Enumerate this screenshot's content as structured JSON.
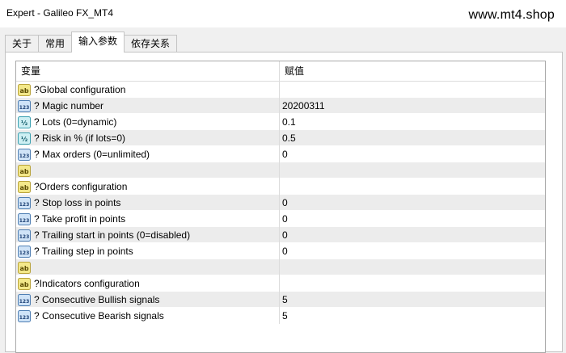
{
  "window": {
    "title": "Expert - Galileo FX_MT4",
    "watermark": "www.mt4.shop"
  },
  "tabs": [
    {
      "label": "关于",
      "active": false
    },
    {
      "label": "常用",
      "active": false
    },
    {
      "label": "输入参数",
      "active": true
    },
    {
      "label": "依存关系",
      "active": false
    }
  ],
  "table": {
    "headers": [
      "变量",
      "赋值"
    ],
    "rows": [
      {
        "icon": "ab-string-icon",
        "name": "?Global configuration",
        "value": ""
      },
      {
        "icon": "integer-123-icon",
        "name": "? Magic number",
        "value": "20200311"
      },
      {
        "icon": "double-fraction-icon",
        "name": "? Lots (0=dynamic)",
        "value": "0.1"
      },
      {
        "icon": "double-fraction-icon",
        "name": "? Risk in % (if lots=0)",
        "value": "0.5"
      },
      {
        "icon": "integer-123-icon",
        "name": "? Max orders (0=unlimited)",
        "value": "0"
      },
      {
        "icon": "ab-string-icon",
        "name": "",
        "value": ""
      },
      {
        "icon": "ab-string-icon",
        "name": "?Orders configuration",
        "value": ""
      },
      {
        "icon": "integer-123-icon",
        "name": "? Stop loss in points",
        "value": "0"
      },
      {
        "icon": "integer-123-icon",
        "name": "? Take profit in points",
        "value": "0"
      },
      {
        "icon": "integer-123-icon",
        "name": "? Trailing start in points (0=disabled)",
        "value": "0"
      },
      {
        "icon": "integer-123-icon",
        "name": "? Trailing step in points",
        "value": "0"
      },
      {
        "icon": "ab-string-icon",
        "name": "",
        "value": ""
      },
      {
        "icon": "ab-string-icon",
        "name": "?Indicators configuration",
        "value": ""
      },
      {
        "icon": "integer-123-icon",
        "name": "? Consecutive Bullish signals",
        "value": "5"
      },
      {
        "icon": "integer-123-icon",
        "name": "? Consecutive Bearish signals",
        "value": "5"
      }
    ]
  },
  "icons": {
    "ab-string-icon": {
      "glyph": "ab",
      "bg": "#f3e88a",
      "border": "#b9a33a",
      "fg": "#5a4a00"
    },
    "integer-123-icon": {
      "glyph": "123",
      "bg": "#cfe3f7",
      "border": "#4f7fb3",
      "fg": "#1b3f73"
    },
    "double-fraction-icon": {
      "glyph": "½",
      "bg": "#cdeff3",
      "border": "#3aa0b0",
      "fg": "#0c5866"
    }
  }
}
